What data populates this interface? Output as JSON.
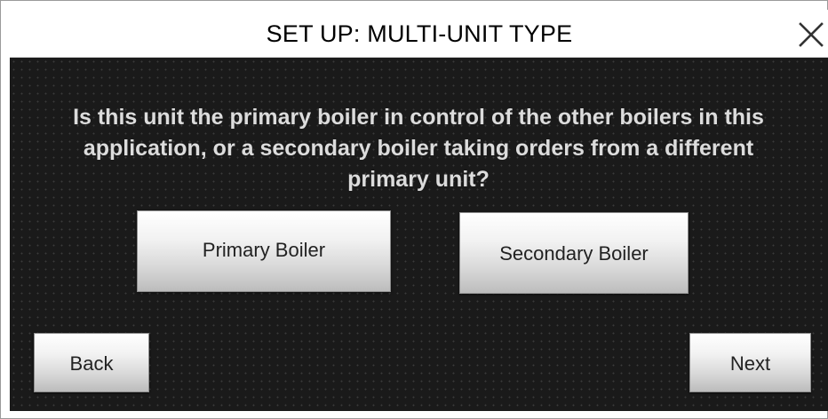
{
  "header": {
    "title": "SET UP: MULTI-UNIT TYPE",
    "close_icon": "close-icon"
  },
  "main": {
    "question": "Is this unit the primary boiler in control of the other boilers in this application, or a secondary boiler taking orders from a different primary unit?",
    "options": {
      "primary_label": "Primary Boiler",
      "secondary_label": "Secondary Boiler"
    }
  },
  "footer": {
    "back_label": "Back",
    "next_label": "Next"
  },
  "colors": {
    "panel_background": "#1a1a1a",
    "question_text": "#dcdcdc",
    "title_text": "#000000",
    "button_text": "#222222"
  }
}
